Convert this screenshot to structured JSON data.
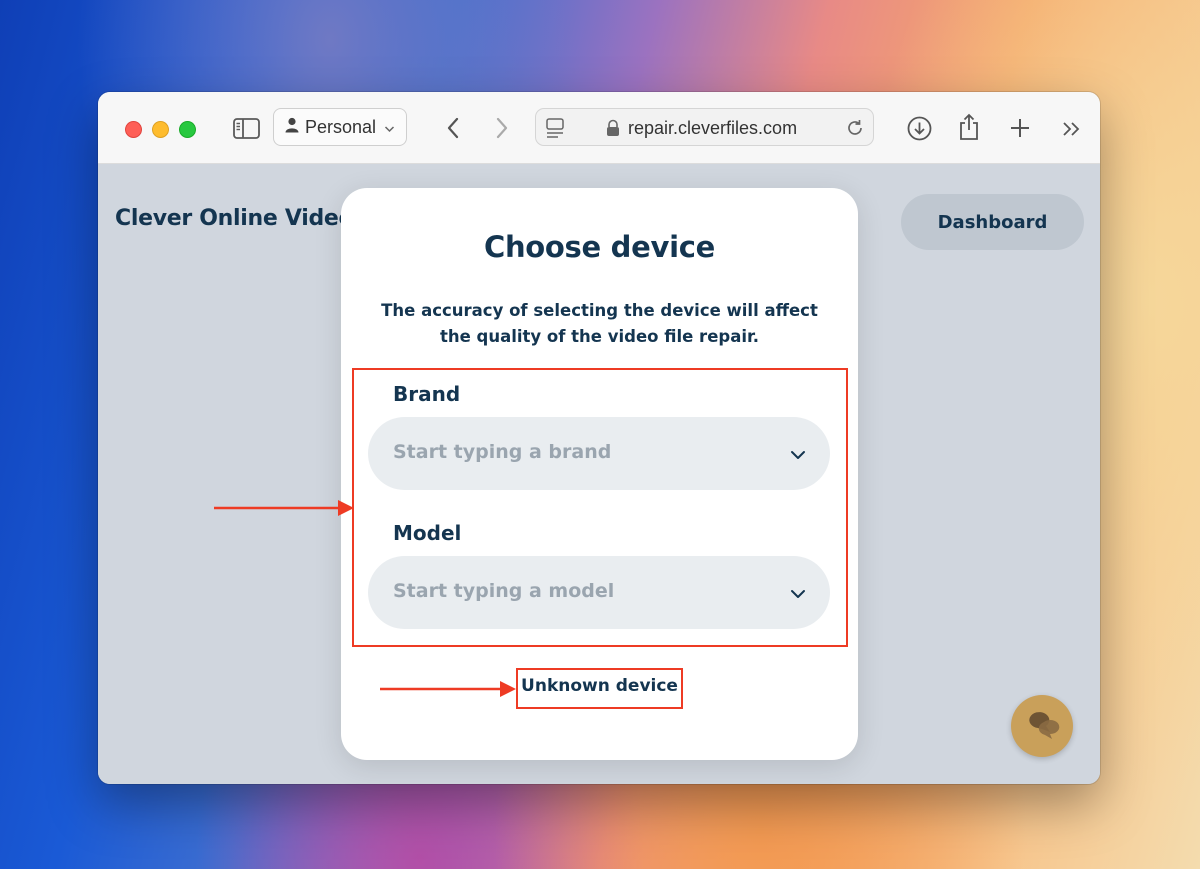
{
  "browser": {
    "profile_label": "Personal",
    "address": "repair.cleverfiles.com"
  },
  "page": {
    "site_title": "Clever Online Video Repair",
    "dashboard_label": "Dashboard"
  },
  "modal": {
    "title": "Choose device",
    "subtitle": "The accuracy of selecting the device will affect the quality of the video file repair.",
    "brand_label": "Brand",
    "brand_placeholder": "Start typing a brand",
    "model_label": "Model",
    "model_placeholder": "Start typing a model",
    "unknown_device_label": "Unknown device"
  },
  "colors": {
    "accent_text": "#143550",
    "annotation": "#ee3b24",
    "chat_button": "#c9a05a"
  },
  "icons": [
    "sidebar-icon",
    "person-icon",
    "chevron-down-icon",
    "back-icon",
    "forward-icon",
    "reader-icon",
    "lock-icon",
    "reload-icon",
    "download-icon",
    "share-icon",
    "plus-icon",
    "more-chevrons-icon",
    "chat-icon"
  ]
}
